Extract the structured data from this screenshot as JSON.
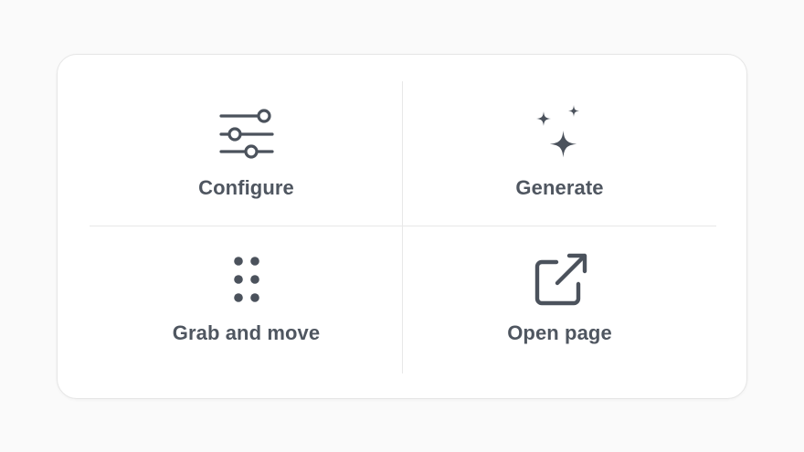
{
  "colors": {
    "background": "#fafafa",
    "card": "#ffffff",
    "icon": "#4b525c",
    "label": "#4f5660",
    "divider": "#e8e8e8"
  },
  "tiles": [
    {
      "label": "Configure",
      "icon": "sliders-icon"
    },
    {
      "label": "Generate",
      "icon": "sparkles-icon"
    },
    {
      "label": "Grab and move",
      "icon": "drag-handle-icon"
    },
    {
      "label": "Open page",
      "icon": "external-link-icon"
    }
  ]
}
